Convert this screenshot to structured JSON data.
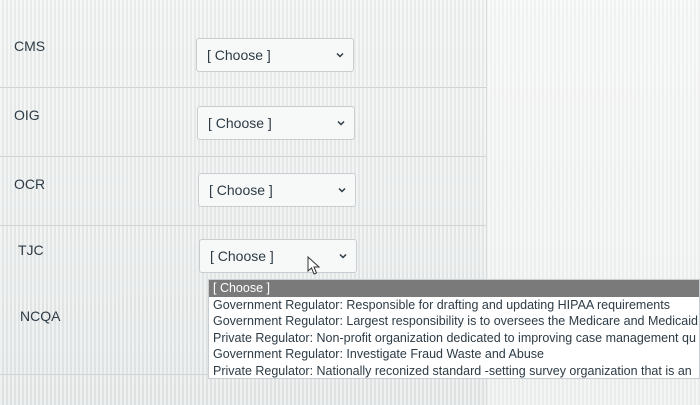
{
  "rows": [
    {
      "label": "CMS",
      "select_value": "[ Choose ]"
    },
    {
      "label": "OIG",
      "select_value": "[ Choose ]"
    },
    {
      "label": "OCR",
      "select_value": "[ Choose ]"
    },
    {
      "label": "TJC",
      "select_value": "[ Choose ]"
    },
    {
      "label": "NCQA"
    }
  ],
  "dropdown": {
    "options": [
      "[ Choose ]",
      "Government Regulator: Responsible for drafting and updating HIPAA requirements",
      "Government Regulator: Largest responsibility is to oversees the Medicare and Medicaid",
      "Private Regulator: Non-profit organization dedicated to improving case management qu",
      "Government Regulator: Investigate Fraud Waste and Abuse",
      "Private Regulator: Nationally reconized standard -setting survey organization that is an"
    ],
    "selected_index": 0
  },
  "icons": {
    "select_chevron": "chevron-down-icon",
    "mouse_cursor": "mouse-cursor-icon"
  },
  "colors": {
    "selected_option_bg": "#7a7a7a",
    "text": "#2d3b45"
  }
}
